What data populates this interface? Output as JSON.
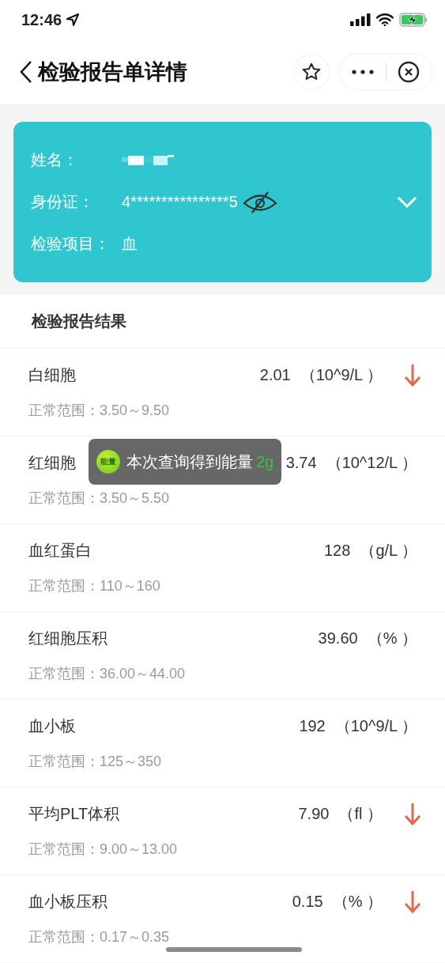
{
  "status_bar": {
    "time": "12:46"
  },
  "header": {
    "title": "检验报告单详情"
  },
  "patient": {
    "expanded": false,
    "fields": [
      {
        "kind": "name",
        "label": "姓名："
      },
      {
        "kind": "id",
        "label": "身份证：",
        "value": "4****************5",
        "hidden": true
      },
      {
        "kind": "text",
        "label": "检验项目：",
        "value": "血"
      }
    ]
  },
  "results": {
    "title": "检验报告结果",
    "rows": [
      {
        "name": "白细胞",
        "value": "2.01",
        "unit": "（10^9/L ）",
        "below_range": true,
        "range": "正常范围：3.50～9.50"
      },
      {
        "name": "红细胞",
        "value": "3.74",
        "unit": "（10^12/L ）",
        "below_range": false,
        "range": "正常范围：3.50～5.50"
      },
      {
        "name": "血红蛋白",
        "value": "128",
        "unit": "（g/L ）",
        "below_range": false,
        "range": "正常范围：110～160"
      },
      {
        "name": "红细胞压积",
        "value": "39.60",
        "unit": "（% ）",
        "below_range": false,
        "range": "正常范围：36.00～44.00"
      },
      {
        "name": "血小板",
        "value": "192",
        "unit": "（10^9/L ）",
        "below_range": false,
        "range": "正常范围：125～350"
      },
      {
        "name": "平均PLT体积",
        "value": "7.90",
        "unit": "（fl ）",
        "below_range": true,
        "range": "正常范围：9.00～13.00"
      },
      {
        "name": "血小板压积",
        "value": "0.15",
        "unit": "（% ）",
        "below_range": true,
        "range": "正常范围：0.17～0.35"
      }
    ]
  },
  "toast": {
    "badge": "能量",
    "text": "本次查询得到能量",
    "amount": "2g"
  }
}
